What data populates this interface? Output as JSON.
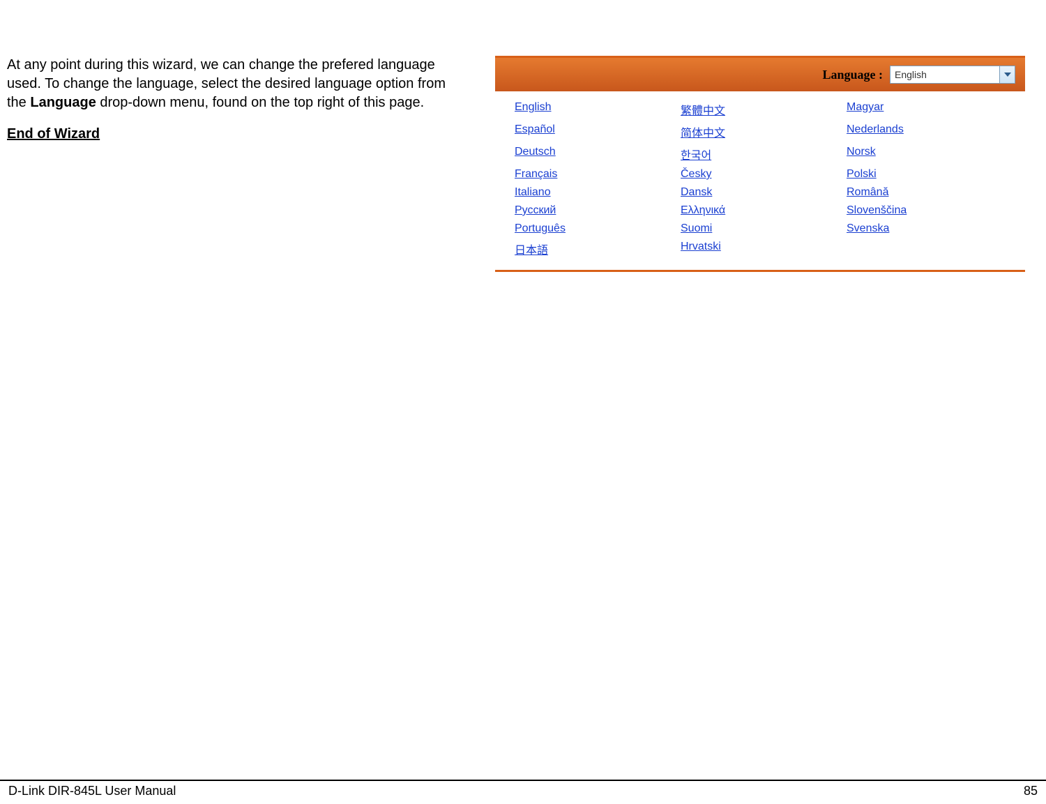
{
  "text": {
    "intro_pre": "At any point during this wizard, we can change the prefered language used. To change the language, select the desired language option from the ",
    "intro_bold": "Language",
    "intro_post": " drop-down menu, found on the top right of this page.",
    "end_wizard": "End of Wizard"
  },
  "panel": {
    "label": "Language :",
    "selected": "English",
    "columns": {
      "col1": [
        "English",
        "Español",
        "Deutsch",
        "Français",
        "Italiano",
        "Русский",
        "Português",
        "日本語"
      ],
      "col2": [
        "繁體中文",
        "简体中文",
        "한국어",
        "Česky",
        "Dansk",
        "Ελληνικά",
        "Suomi",
        "Hrvatski"
      ],
      "col3": [
        "Magyar",
        "Nederlands",
        "Norsk",
        "Polski",
        "Română",
        "Slovenščina",
        "Svenska"
      ]
    }
  },
  "footer": {
    "manual": "D-Link DIR-845L User Manual",
    "page": "85"
  }
}
